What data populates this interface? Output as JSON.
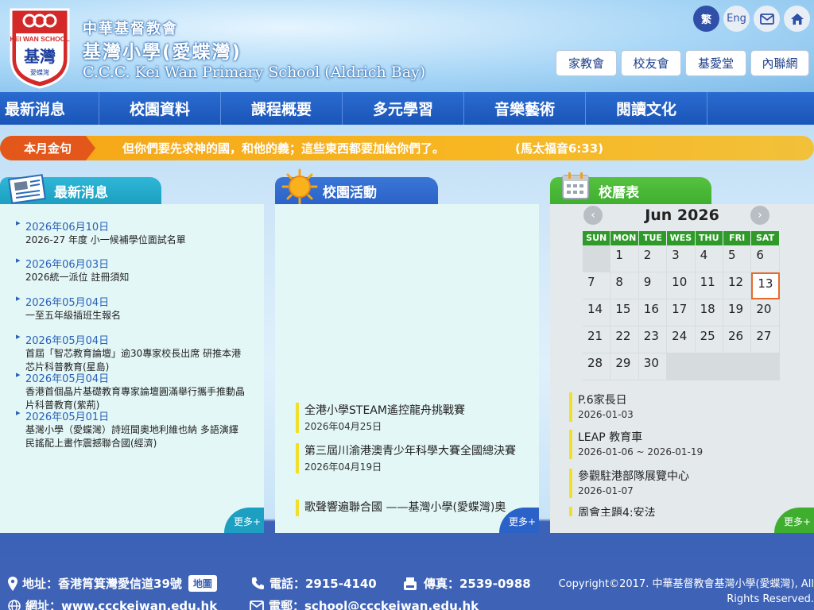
{
  "header": {
    "title_cn_line1": "中華基督教會",
    "title_cn_line2": "基灣小學(愛蝶灣)",
    "title_en": "C.C.C. Kei Wan Primary School (Aldrich Bay)",
    "logo_text_top": "KEI WAN SCHOOL",
    "logo_text_mid": "基灣",
    "logo_text_bot": "愛蝶灣",
    "lang_tc": "繁",
    "lang_en": "Eng",
    "quick_links": [
      "家教會",
      "校友會",
      "基愛堂",
      "內聯網"
    ]
  },
  "nav": [
    "最新消息",
    "校園資料",
    "課程概要",
    "多元學習",
    "音樂藝術",
    "閱讀文化"
  ],
  "verse": {
    "label": "本月金句",
    "text": "但你們要先求神的國，和他的義；這些東西都要加給你們了。",
    "ref": "(馬太福音6:33)"
  },
  "news": {
    "title": "最新消息",
    "more": "更多+",
    "items": [
      {
        "date": "2026年06月10日",
        "title": "2026-27 年度 小一候補學位面試名單"
      },
      {
        "date": "2026年06月03日",
        "title": "2026統一派位 註冊須知"
      },
      {
        "date": "2026年05月04日",
        "title": "一至五年級插班生報名"
      },
      {
        "date": "2026年05月04日",
        "title": "首屆「智芯教育論壇」逾30專家校長出席 研推本港芯片科普教育(星島)"
      },
      {
        "date": "2026年05月04日",
        "title": "香港首個晶片基礎教育專家論壇圓滿舉行攜手推動晶片科普教育(紫荊)"
      },
      {
        "date": "2026年05月01日",
        "title": "基灣小學（愛蝶灣）詩班聞奧地利維也納 多語演繹民謠配上畫作震撼聯合國(經濟)"
      }
    ]
  },
  "activities": {
    "title": "校園活動",
    "more": "更多+",
    "items": [
      {
        "title": "全港小學STEAM遙控龍舟挑戰賽",
        "date": "2026年04月25日"
      },
      {
        "title": "第三屆川渝港澳青少年科學大賽全國總決賽",
        "date": "2026年04月19日"
      },
      {
        "title": "歌聲響遍聯合國 ——基灣小學(愛蝶灣)奧",
        "date": ""
      }
    ]
  },
  "calendar": {
    "title": "校曆表",
    "month": "Jun 2026",
    "more": "更多+",
    "prev": "‹",
    "next": "›",
    "weekdays": [
      "SUN",
      "MON",
      "TUE",
      "WES",
      "THU",
      "FRI",
      "SAT"
    ],
    "weeks": [
      [
        "",
        "1",
        "2",
        "3",
        "4",
        "5",
        "6"
      ],
      [
        "7",
        "8",
        "9",
        "10",
        "11",
        "12",
        "13"
      ],
      [
        "14",
        "15",
        "16",
        "17",
        "18",
        "19",
        "20"
      ],
      [
        "21",
        "22",
        "23",
        "24",
        "25",
        "26",
        "27"
      ],
      [
        "28",
        "29",
        "30",
        "",
        "",
        "",
        ""
      ]
    ],
    "today": "13",
    "events": [
      {
        "title": "P.6家長日",
        "date": "2026-01-03"
      },
      {
        "title": "LEAP 教育車",
        "date": "2026-01-06 ~ 2026-01-19"
      },
      {
        "title": "參觀駐港部隊展覽中心",
        "date": "2026-01-07"
      },
      {
        "title": "周會主題4:安法",
        "date": ""
      }
    ]
  },
  "footer": {
    "address": "地址：香港筲箕灣愛信道39號",
    "map": "地圖",
    "phone": "電話：2915-4140",
    "fax": "傳真：2539-0988",
    "website": "網址：www.ccckeiwan.edu.hk",
    "email": "電郵：school@ccckeiwan.edu.hk",
    "copyright": "Copyright©2017. 中華基督教會基灣小學(愛蝶灣), All Rights Reserved."
  },
  "colors": {
    "nav": "#1a55b8",
    "verse_label": "#e4571a",
    "verse_bar": "#f7b723",
    "news_tab": "#1c9fc0",
    "activity_tab": "#2b62c8",
    "calendar_tab": "#3fae2f",
    "calendar_head": "#2f9a2a",
    "footer": "#3d62b6"
  }
}
